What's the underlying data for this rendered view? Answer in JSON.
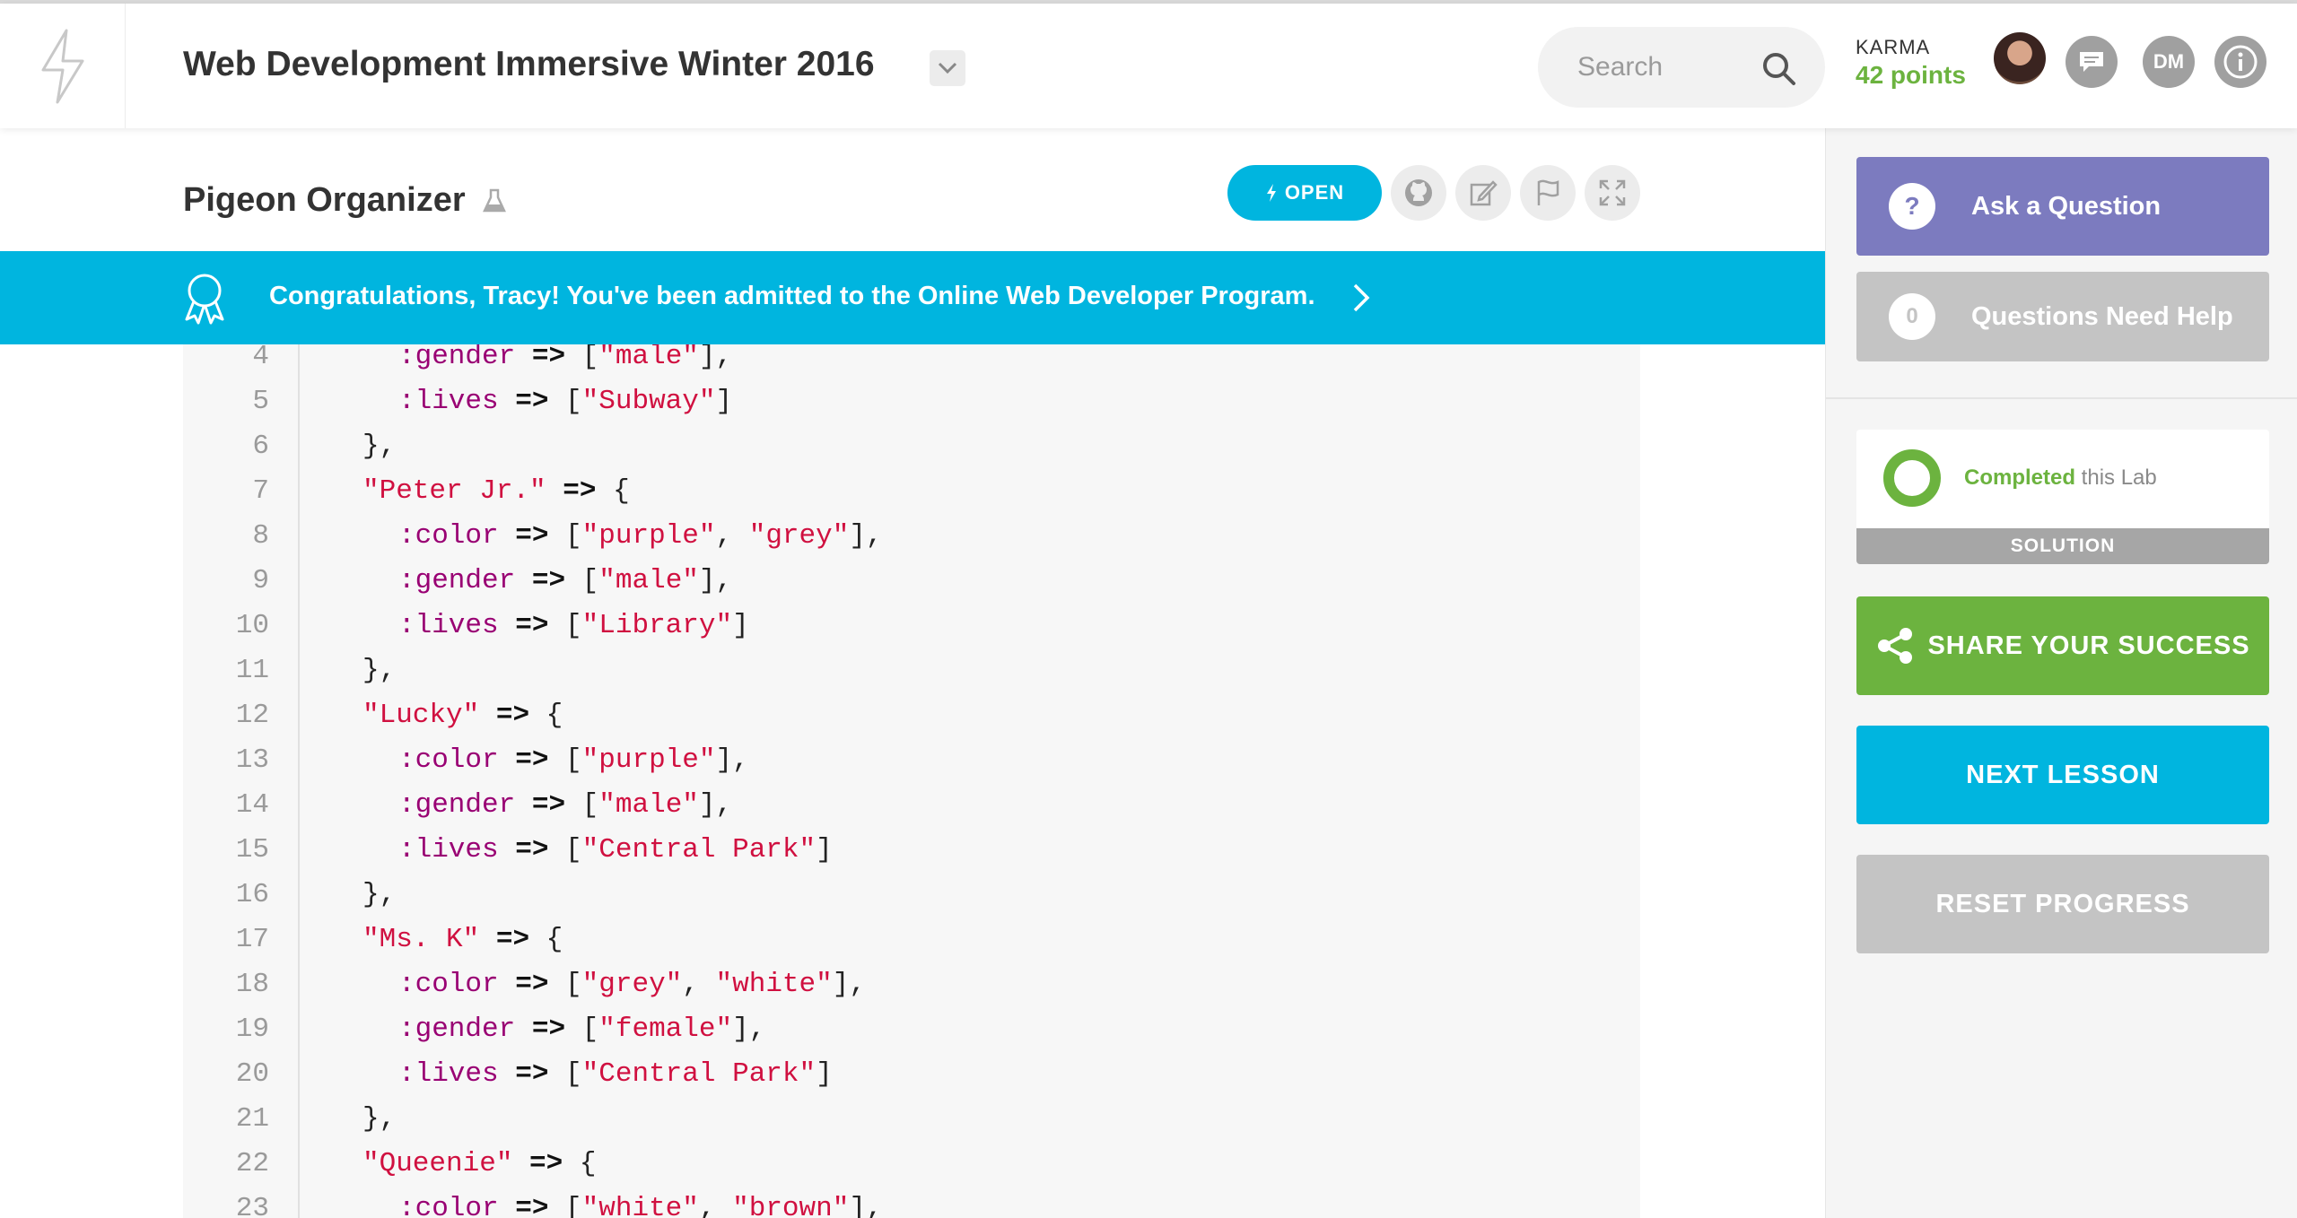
{
  "header": {
    "course_title": "Web Development Immersive Winter 2016",
    "search_placeholder": "Search",
    "karma_label": "KARMA",
    "karma_points": "42 points",
    "user_initials": "DM"
  },
  "lab": {
    "title": "Pigeon Organizer",
    "open_label": "OPEN"
  },
  "banner": {
    "text": "Congratulations, Tracy! You've been admitted to the Online Web Developer Program."
  },
  "code": {
    "lines": [
      {
        "n": "4",
        "indent": 2,
        "tokens": [
          {
            "t": ":gender",
            "k": "sym"
          },
          {
            "t": " ",
            "k": ""
          },
          {
            "t": "=>",
            "k": "op"
          },
          {
            "t": " [",
            "k": ""
          },
          {
            "t": "\"male\"",
            "k": "str"
          },
          {
            "t": "],",
            "k": ""
          }
        ]
      },
      {
        "n": "5",
        "indent": 2,
        "tokens": [
          {
            "t": ":lives",
            "k": "sym"
          },
          {
            "t": " ",
            "k": ""
          },
          {
            "t": "=>",
            "k": "op"
          },
          {
            "t": " [",
            "k": ""
          },
          {
            "t": "\"Subway\"",
            "k": "str"
          },
          {
            "t": "]",
            "k": ""
          }
        ]
      },
      {
        "n": "6",
        "indent": 1,
        "tokens": [
          {
            "t": "},",
            "k": ""
          }
        ]
      },
      {
        "n": "7",
        "indent": 1,
        "tokens": [
          {
            "t": "\"Peter Jr.\"",
            "k": "str"
          },
          {
            "t": " ",
            "k": ""
          },
          {
            "t": "=>",
            "k": "op"
          },
          {
            "t": " {",
            "k": ""
          }
        ]
      },
      {
        "n": "8",
        "indent": 2,
        "tokens": [
          {
            "t": ":color",
            "k": "sym"
          },
          {
            "t": " ",
            "k": ""
          },
          {
            "t": "=>",
            "k": "op"
          },
          {
            "t": " [",
            "k": ""
          },
          {
            "t": "\"purple\"",
            "k": "str"
          },
          {
            "t": ", ",
            "k": ""
          },
          {
            "t": "\"grey\"",
            "k": "str"
          },
          {
            "t": "],",
            "k": ""
          }
        ]
      },
      {
        "n": "9",
        "indent": 2,
        "tokens": [
          {
            "t": ":gender",
            "k": "sym"
          },
          {
            "t": " ",
            "k": ""
          },
          {
            "t": "=>",
            "k": "op"
          },
          {
            "t": " [",
            "k": ""
          },
          {
            "t": "\"male\"",
            "k": "str"
          },
          {
            "t": "],",
            "k": ""
          }
        ]
      },
      {
        "n": "10",
        "indent": 2,
        "tokens": [
          {
            "t": ":lives",
            "k": "sym"
          },
          {
            "t": " ",
            "k": ""
          },
          {
            "t": "=>",
            "k": "op"
          },
          {
            "t": " [",
            "k": ""
          },
          {
            "t": "\"Library\"",
            "k": "str"
          },
          {
            "t": "]",
            "k": ""
          }
        ]
      },
      {
        "n": "11",
        "indent": 1,
        "tokens": [
          {
            "t": "},",
            "k": ""
          }
        ]
      },
      {
        "n": "12",
        "indent": 1,
        "tokens": [
          {
            "t": "\"Lucky\"",
            "k": "str"
          },
          {
            "t": " ",
            "k": ""
          },
          {
            "t": "=>",
            "k": "op"
          },
          {
            "t": " {",
            "k": ""
          }
        ]
      },
      {
        "n": "13",
        "indent": 2,
        "tokens": [
          {
            "t": ":color",
            "k": "sym"
          },
          {
            "t": " ",
            "k": ""
          },
          {
            "t": "=>",
            "k": "op"
          },
          {
            "t": " [",
            "k": ""
          },
          {
            "t": "\"purple\"",
            "k": "str"
          },
          {
            "t": "],",
            "k": ""
          }
        ]
      },
      {
        "n": "14",
        "indent": 2,
        "tokens": [
          {
            "t": ":gender",
            "k": "sym"
          },
          {
            "t": " ",
            "k": ""
          },
          {
            "t": "=>",
            "k": "op"
          },
          {
            "t": " [",
            "k": ""
          },
          {
            "t": "\"male\"",
            "k": "str"
          },
          {
            "t": "],",
            "k": ""
          }
        ]
      },
      {
        "n": "15",
        "indent": 2,
        "tokens": [
          {
            "t": ":lives",
            "k": "sym"
          },
          {
            "t": " ",
            "k": ""
          },
          {
            "t": "=>",
            "k": "op"
          },
          {
            "t": " [",
            "k": ""
          },
          {
            "t": "\"Central Park\"",
            "k": "str"
          },
          {
            "t": "]",
            "k": ""
          }
        ]
      },
      {
        "n": "16",
        "indent": 1,
        "tokens": [
          {
            "t": "},",
            "k": ""
          }
        ]
      },
      {
        "n": "17",
        "indent": 1,
        "tokens": [
          {
            "t": "\"Ms. K\"",
            "k": "str"
          },
          {
            "t": " ",
            "k": ""
          },
          {
            "t": "=>",
            "k": "op"
          },
          {
            "t": " {",
            "k": ""
          }
        ]
      },
      {
        "n": "18",
        "indent": 2,
        "tokens": [
          {
            "t": ":color",
            "k": "sym"
          },
          {
            "t": " ",
            "k": ""
          },
          {
            "t": "=>",
            "k": "op"
          },
          {
            "t": " [",
            "k": ""
          },
          {
            "t": "\"grey\"",
            "k": "str"
          },
          {
            "t": ", ",
            "k": ""
          },
          {
            "t": "\"white\"",
            "k": "str"
          },
          {
            "t": "],",
            "k": ""
          }
        ]
      },
      {
        "n": "19",
        "indent": 2,
        "tokens": [
          {
            "t": ":gender",
            "k": "sym"
          },
          {
            "t": " ",
            "k": ""
          },
          {
            "t": "=>",
            "k": "op"
          },
          {
            "t": " [",
            "k": ""
          },
          {
            "t": "\"female\"",
            "k": "str"
          },
          {
            "t": "],",
            "k": ""
          }
        ]
      },
      {
        "n": "20",
        "indent": 2,
        "tokens": [
          {
            "t": ":lives",
            "k": "sym"
          },
          {
            "t": " ",
            "k": ""
          },
          {
            "t": "=>",
            "k": "op"
          },
          {
            "t": " [",
            "k": ""
          },
          {
            "t": "\"Central Park\"",
            "k": "str"
          },
          {
            "t": "]",
            "k": ""
          }
        ]
      },
      {
        "n": "21",
        "indent": 1,
        "tokens": [
          {
            "t": "},",
            "k": ""
          }
        ]
      },
      {
        "n": "22",
        "indent": 1,
        "tokens": [
          {
            "t": "\"Queenie\"",
            "k": "str"
          },
          {
            "t": " ",
            "k": ""
          },
          {
            "t": "=>",
            "k": "op"
          },
          {
            "t": " {",
            "k": ""
          }
        ]
      },
      {
        "n": "23",
        "indent": 2,
        "tokens": [
          {
            "t": ":color",
            "k": "sym"
          },
          {
            "t": " ",
            "k": ""
          },
          {
            "t": "=>",
            "k": "op"
          },
          {
            "t": " [",
            "k": ""
          },
          {
            "t": "\"white\"",
            "k": "str"
          },
          {
            "t": ", ",
            "k": ""
          },
          {
            "t": "\"brown\"",
            "k": "str"
          },
          {
            "t": "],",
            "k": ""
          }
        ]
      }
    ]
  },
  "sidebar": {
    "ask_question": "Ask a Question",
    "questions_count": "0",
    "questions_need_help": "Questions Need Help",
    "completed_bold": "Completed",
    "completed_rest": " this Lab",
    "solution": "SOLUTION",
    "share": "SHARE YOUR SUCCESS",
    "next_lesson": "NEXT LESSON",
    "reset_progress": "RESET PROGRESS"
  },
  "colors": {
    "accent_blue": "#00b5df",
    "purple": "#7c7bbf",
    "green": "#6cb33f",
    "grey_button": "#c4c4c4"
  },
  "icons": [
    "logo-bolt-icon",
    "chevron-down-icon",
    "search-icon",
    "chat-icon",
    "info-icon",
    "flask-icon",
    "bolt-icon",
    "github-icon",
    "edit-icon",
    "flag-icon",
    "expand-icon",
    "ribbon-icon",
    "chevron-right-icon",
    "question-icon",
    "share-icon"
  ]
}
